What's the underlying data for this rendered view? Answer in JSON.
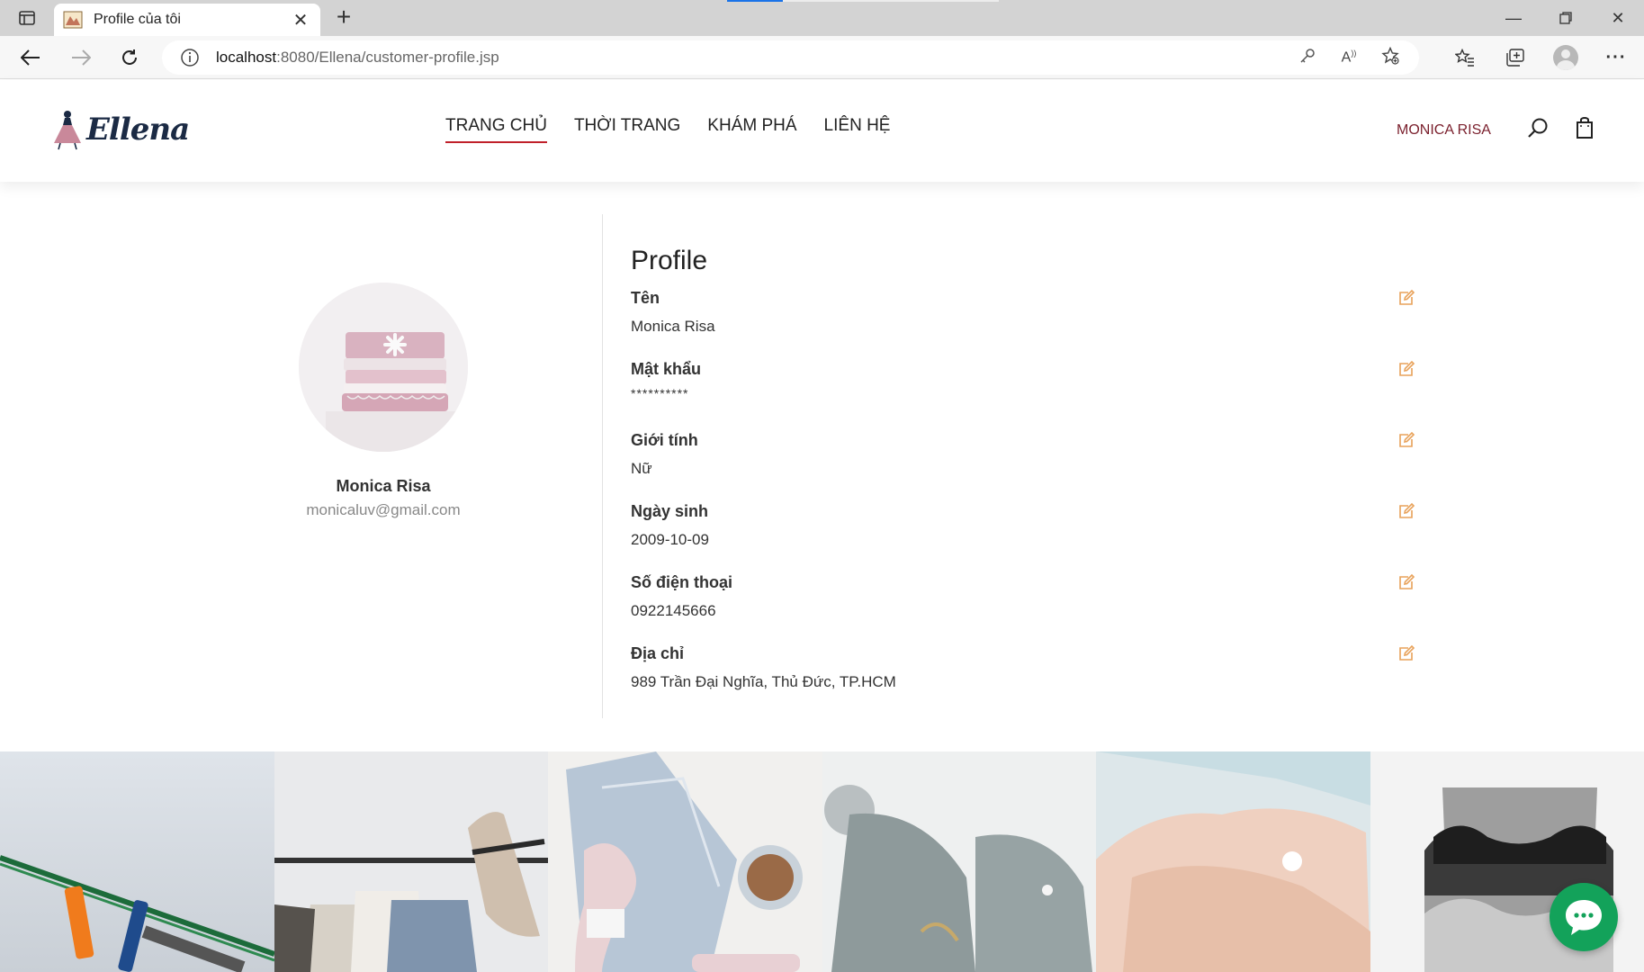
{
  "browser": {
    "tab_title": "Profile của tôi",
    "url_host": "localhost",
    "url_path": ":8080/Ellena/customer-profile.jsp"
  },
  "site": {
    "logo_text": "Ellena",
    "nav": [
      "TRANG CHỦ",
      "THỜI TRANG",
      "KHÁM PHÁ",
      "LIÊN HỆ"
    ],
    "user_name": "MONICA RISA"
  },
  "profile": {
    "display_name": "Monica Risa",
    "email": "monicaluv@gmail.com",
    "title": "Profile",
    "fields": [
      {
        "label": "Tên",
        "value": "Monica Risa"
      },
      {
        "label": "Mật khẩu",
        "value": "**********"
      },
      {
        "label": "Giới tính",
        "value": "Nữ"
      },
      {
        "label": "Ngày sinh",
        "value": "2009-10-09"
      },
      {
        "label": "Số điện thoại",
        "value": "0922145666"
      },
      {
        "label": "Địa chỉ",
        "value": "989 Trần Đại Nghĩa, Thủ Đức, TP.HCM"
      }
    ]
  },
  "colors": {
    "accent_red": "#c0202a",
    "edit_icon": "#e8a25a",
    "chat_green": "#13a25a"
  },
  "icons": {
    "search": "search-icon",
    "cart": "shopping-bag-icon",
    "edit": "edit-icon",
    "chat": "chat-bubble-icon"
  }
}
